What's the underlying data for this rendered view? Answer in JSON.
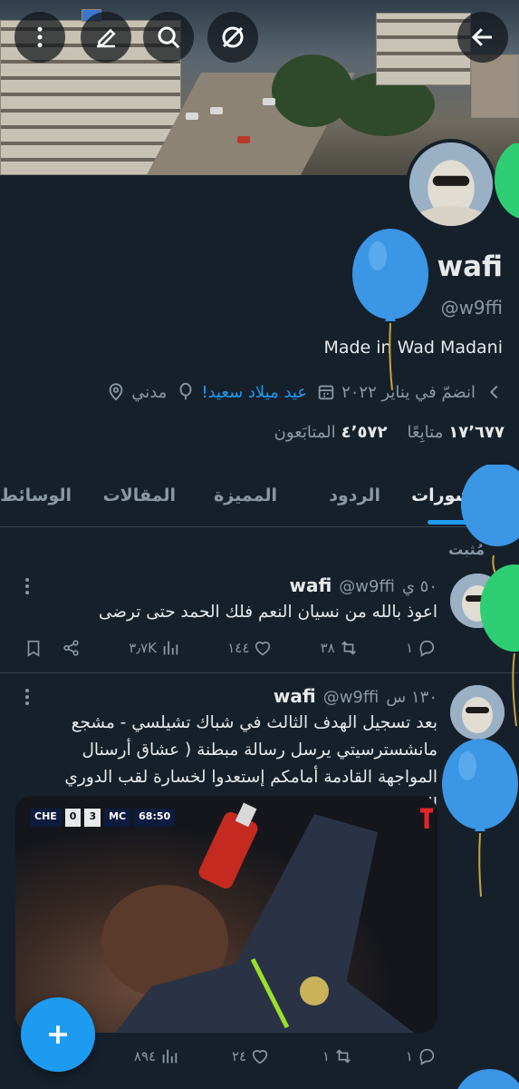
{
  "header": {
    "back_icon": "arrow-left-icon",
    "buttons": [
      "more-icon",
      "edit-icon",
      "search-icon",
      "circle-slash-icon"
    ]
  },
  "profile": {
    "name": "wafi",
    "handle": "@w9ffi",
    "bio": "Made in Wad Madani",
    "location": "مدني",
    "birthday": "عيد ميلاد سعيد!",
    "joined": "انضمّ في يناير ٢٠٢٢",
    "followers_count": "٤٬٥٧٢",
    "followers_label": "المتابَعون",
    "following_count": "١٧٬٦٧٧",
    "following_label": "متابِعًا"
  },
  "tabs": [
    "المنشورات",
    "الردود",
    "المميزة",
    "المقالات",
    "الوسائط"
  ],
  "pinned_label": "مُثبت",
  "tweets": [
    {
      "name": "wafi",
      "handle": "@w9ffi",
      "time": "٥٠ ي",
      "text": "اعوذ بالله من نسيان النعم فلك الحمد حتى ترضى",
      "replies": "١",
      "retweets": "٣٨",
      "likes": "١٤٤",
      "views": "٣٫٧K"
    },
    {
      "name": "wafi",
      "handle": "@w9ffi",
      "time": "١٣٠ س",
      "text": "بعد تسجيل الهدف الثالث في شباك تشيلسي - مشجع مانشسترسيتي يرسل رسالة مبطنة ( عشاق أرسنال المواجهة القادمة أمامكم إستعدوا لخسارة لقب الدوري الإنجليزي )",
      "replies": "١",
      "retweets": "١",
      "likes": "٢٤",
      "views": "٨٩٤"
    }
  ],
  "media_score": {
    "home": "CHE",
    "home_goals": "0",
    "away_goals": "3",
    "away": "MC",
    "clock": "68:50"
  },
  "fab_icon": "plus-icon",
  "colors": {
    "background": "#15202b",
    "accent": "#1d9bf0",
    "muted": "#8b98a5",
    "balloon_blue": "#3b96e6",
    "balloon_green": "#2ecf74"
  }
}
